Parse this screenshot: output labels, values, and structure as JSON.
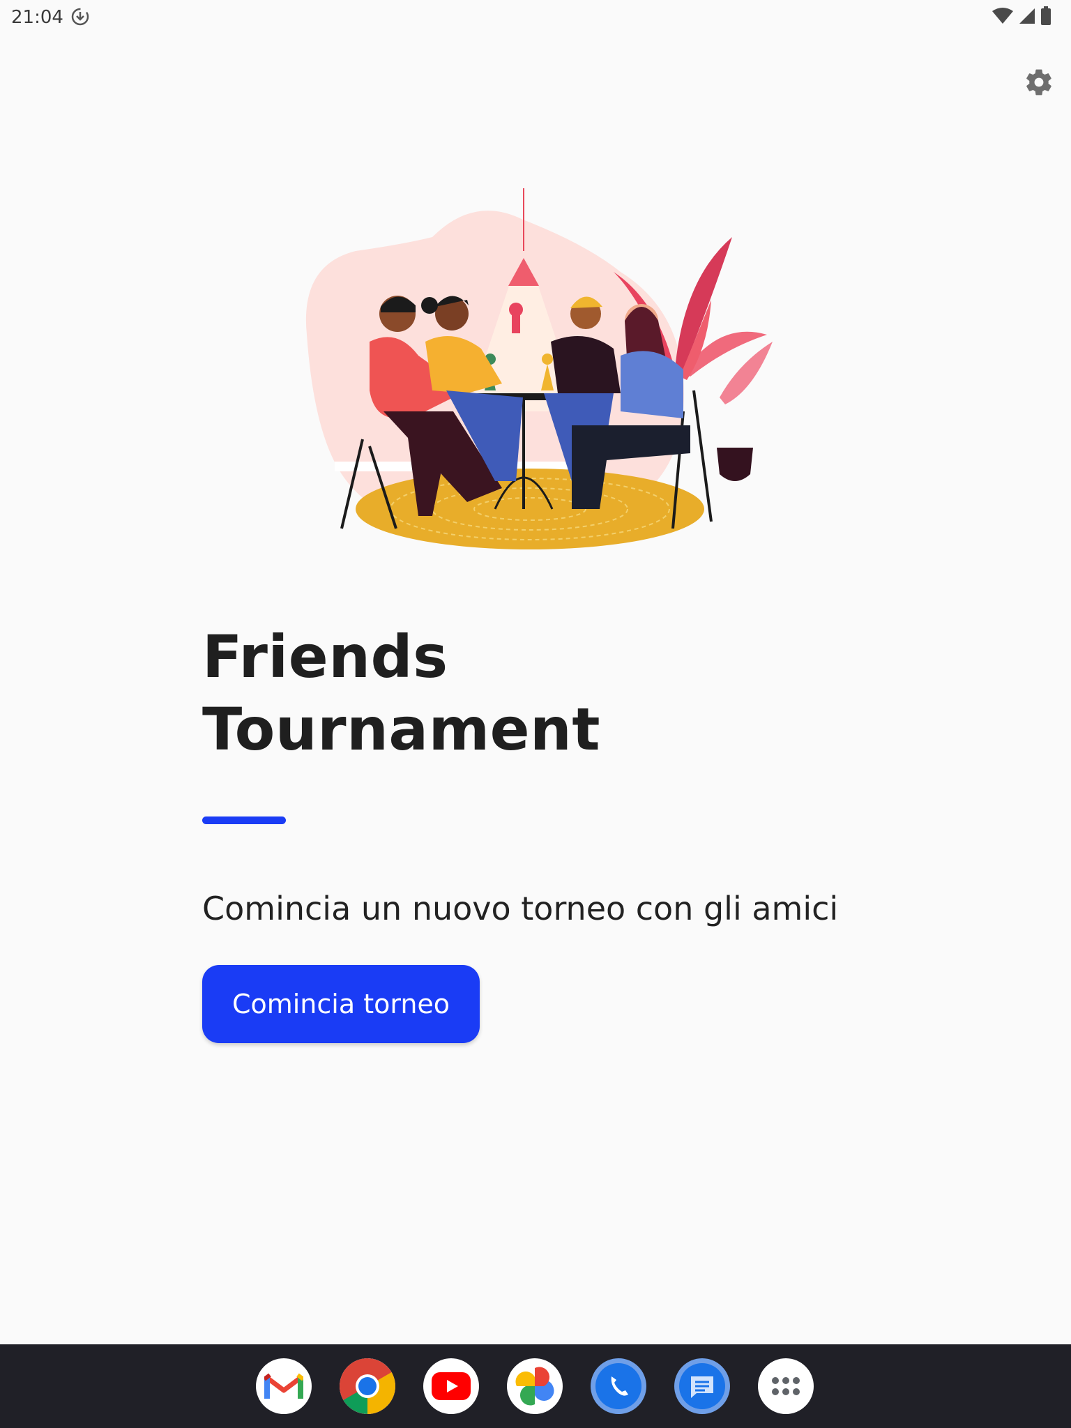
{
  "status_bar": {
    "time": "21:04",
    "icons": [
      "download-status-icon",
      "wifi-icon",
      "signal-icon",
      "battery-icon"
    ]
  },
  "toolbar": {
    "settings_icon": "gear-icon"
  },
  "main": {
    "title_line1": "Friends",
    "title_line2": "Tournament",
    "subtitle": "Comincia un nuovo torneo con gli amici",
    "start_button_label": "Comincia torneo"
  },
  "taskbar": {
    "apps": [
      {
        "name": "gmail-icon"
      },
      {
        "name": "chrome-icon"
      },
      {
        "name": "youtube-icon"
      },
      {
        "name": "photos-icon"
      },
      {
        "name": "phone-icon"
      },
      {
        "name": "messages-icon"
      },
      {
        "name": "app-drawer-icon"
      }
    ]
  },
  "colors": {
    "accent": "#1a3cf5",
    "background": "#fafafa",
    "title_text": "#1f1f1f",
    "taskbar": "#202027"
  }
}
